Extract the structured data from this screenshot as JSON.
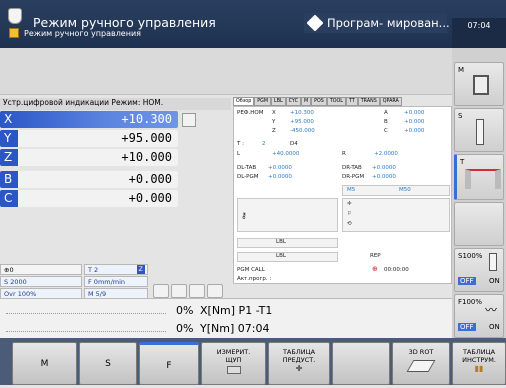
{
  "header": {
    "mode_title": "Режим ручного управления",
    "mode_subtitle": "Режим ручного управления",
    "program_mode": "Програм- мирован...",
    "clock": "07:04"
  },
  "position": {
    "header": "Устр.цифровой индикации Режим: НОМ.",
    "axes": [
      {
        "axis": "X",
        "value": "+10.300"
      },
      {
        "axis": "Y",
        "value": "+95.000"
      },
      {
        "axis": "Z",
        "value": "+10.000"
      },
      {
        "axis": "B",
        "value": "+0.000"
      },
      {
        "axis": "C",
        "value": "+0.000"
      }
    ]
  },
  "tabs": [
    "Обзор",
    "PGM",
    "LBL",
    "CYC",
    "M",
    "POS",
    "TOOL",
    "TT",
    "TRANS",
    "QPARA"
  ],
  "overview": {
    "ref_label": "РЕФ.НОМ",
    "ref_rows": [
      {
        "axis": "X",
        "value": "+10.300"
      },
      {
        "axis": "Y",
        "value": "+95.000"
      },
      {
        "axis": "Z",
        "value": "-450.000"
      }
    ],
    "ref_rows2": [
      {
        "axis": "A",
        "value": "+0.000"
      },
      {
        "axis": "B",
        "value": "+0.000"
      },
      {
        "axis": "C",
        "value": "+0.000"
      }
    ],
    "t_label": "T :",
    "t_num": "2",
    "t_name": "D4",
    "l_label": "L",
    "l_value": "+40.0000",
    "r_label": "R",
    "r_value": "+2.0000",
    "dl_tab": "DL-TAB",
    "dl_tab_v": "+0.0000",
    "dr_tab": "DR-TAB",
    "dr_tab_v": "+0.0000",
    "dl_pgm": "DL-PGM",
    "dl_pgm_v": "+0.0000",
    "dr_pgm": "DR-PGM",
    "dr_pgm_v": "+0.0000",
    "m5": "M5",
    "m50": "M50",
    "lbl1": "LBL",
    "lbl2": "LBL",
    "rep": "REP",
    "pgm_call": "PGM CALL",
    "timer": "00:00:00",
    "active_prog": "Акт.прогр. :"
  },
  "info": {
    "tool_icon_val": "0",
    "t_val": "T 2",
    "z_badge": "Z",
    "s_val": "S 2000",
    "f_val": "F 0mm/min",
    "ovr_val": "Ovr 100%",
    "m_val": "M 5/9"
  },
  "status": {
    "line1_pct": "0%",
    "line1_text": "X[Nm] P1  -T1",
    "line2_pct": "0%",
    "line2_text": "Y[Nm] 07:04"
  },
  "right_keys": {
    "m_label": "M",
    "s_label": "S",
    "t_label": "T",
    "s100": "S100%",
    "off1": "OFF",
    "on1": "ON",
    "f100": "F100%",
    "off2": "OFF",
    "on2": "ON"
  },
  "softkeys": {
    "m": "M",
    "s": "S",
    "f": "F",
    "probe_1": "ИЗМЕРИТ.",
    "probe_2": "ЩУП",
    "preset_1": "ТАБЛИЦА",
    "preset_2": "ПРЕДУСТ.",
    "rot3d": "3D ROT",
    "tooltab_1": "ТАБЛИЦА",
    "tooltab_2": "ИНСТРУМ."
  }
}
